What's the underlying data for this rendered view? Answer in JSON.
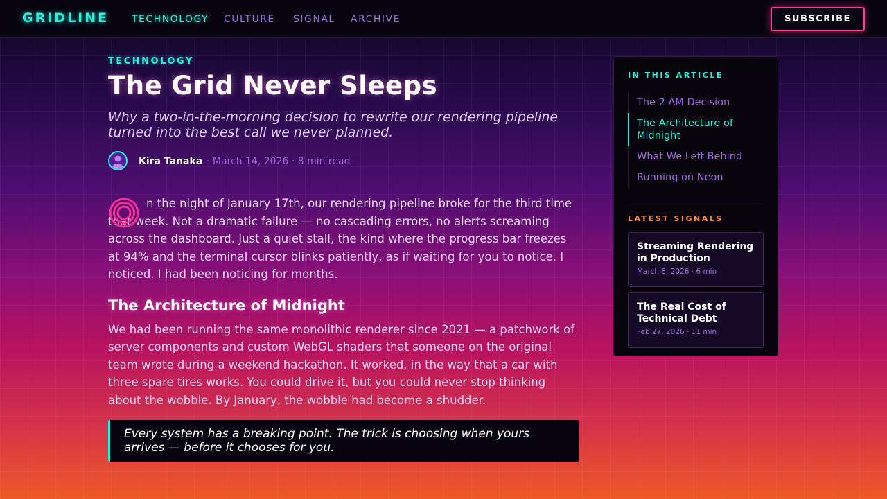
{
  "site": {
    "logo": "GRIDLINE"
  },
  "nav": {
    "links": [
      {
        "label": "TECHNOLOGY",
        "active": true
      },
      {
        "label": "CULTURE",
        "active": false
      },
      {
        "label": "SIGNAL",
        "active": false
      },
      {
        "label": "ARCHIVE",
        "active": false
      }
    ],
    "subscribe_label": "SUBSCRIBE"
  },
  "article": {
    "kicker": "TECHNOLOGY",
    "title": "The Grid Never Sleeps",
    "subtitle": "Why a two-in-the-morning decision to rewrite our rendering pipeline turned into the best call we never planned.",
    "author": "Kira Tanaka",
    "meta": "· March 14, 2026 · 8 min read",
    "paragraph1": "n the night of January 17th, our rendering pipeline broke for the third time that week. Not a dramatic failure — no cascading errors, no alerts screaming across the dashboard. Just a quiet stall, the kind where the progress bar freezes at 94% and the terminal cursor blinks patiently, as if waiting for you to notice. I noticed. I had been noticing for months.",
    "section_heading": "The Architecture of Midnight",
    "paragraph2": "We had been running the same monolithic renderer since 2021 — a patchwork of server components and custom WebGL shaders that someone on the original team wrote during a weekend hackathon. It worked, in the way that a car with three spare tires works. You could drive it, but you could never stop thinking about the wobble. By January, the wobble had become a shudder.",
    "quote": "Every system has a breaking point. The trick is choosing when yours arrives — before it chooses for you."
  },
  "sidebar": {
    "toc_heading": "IN THIS ARTICLE",
    "toc": [
      {
        "label": "The 2 AM Decision",
        "active": false
      },
      {
        "label": "The Architecture of Midnight",
        "active": true
      },
      {
        "label": "What We Left Behind",
        "active": false
      },
      {
        "label": "Running on Neon",
        "active": false
      }
    ],
    "latest_heading": "LATEST SIGNALS",
    "latest": [
      {
        "title": "Streaming Rendering in Production",
        "meta": "March 8, 2026 · 6 min"
      },
      {
        "title": "The Real Cost of Technical Debt",
        "meta": "Feb 27, 2026 · 11 min"
      }
    ]
  },
  "colors": {
    "accent_cyan": "#27f1de",
    "accent_pink": "#ff3d9a",
    "accent_purple": "#a267e6",
    "accent_orange": "#ff8a3c"
  }
}
